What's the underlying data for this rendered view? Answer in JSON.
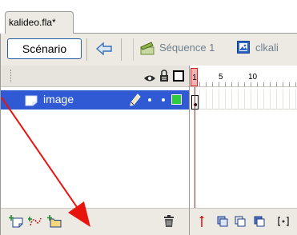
{
  "tab": {
    "title": "kalideo.fla*"
  },
  "toolbar": {
    "scenario_label": "Scénario",
    "back_icon": "back-arrow-icon",
    "sequence_label": "Séquence 1",
    "symbol_label": "clkali"
  },
  "layers": {
    "header_icons": [
      "eye-icon",
      "lock-icon",
      "outline-square-icon"
    ],
    "items": [
      {
        "name": "image",
        "icon": "layer-page-icon",
        "editing": true,
        "outline_color": "#2ecc40"
      }
    ],
    "footer_icons": [
      "add-layer-icon",
      "add-motion-guide-icon",
      "add-folder-icon",
      "trash-icon"
    ]
  },
  "timeline": {
    "current_frame": "1",
    "ruler_labels": [
      "5",
      "10"
    ],
    "footer_icons": [
      "center-frame-icon",
      "onion-skin-icon",
      "onion-skin-outlines-icon",
      "edit-multiple-frames-icon",
      "modify-markers-icon"
    ]
  },
  "colors": {
    "selected_row": "#2f5ad3",
    "playhead": "#d42020",
    "annotation_arrow": "#e8150f"
  }
}
